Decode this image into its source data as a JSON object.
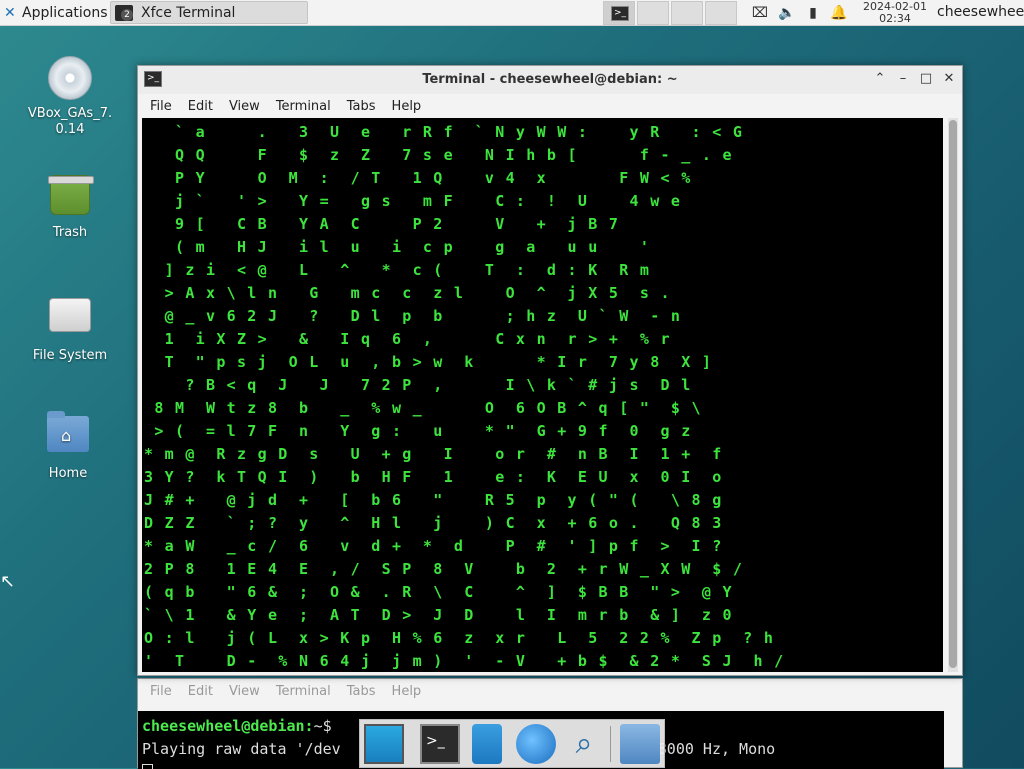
{
  "panel": {
    "applications_label": "Applications",
    "applications_sep": "☰",
    "task_label": "Xfce Terminal",
    "task_badge": "2",
    "clock_date": "2024-02-01",
    "clock_time": "02:34",
    "user": "cheesewheel",
    "tray_icons": [
      "network-icon",
      "volume-icon",
      "battery-icon",
      "notification-bell-icon"
    ]
  },
  "desktop": {
    "icons": [
      {
        "name": "VBox_GAs_7.\n0.14",
        "icon": "disc-icon"
      },
      {
        "name": "Trash",
        "icon": "trash-icon"
      },
      {
        "name": "File System",
        "icon": "drive-icon"
      },
      {
        "name": "Home",
        "icon": "home-folder-icon"
      }
    ]
  },
  "front_window": {
    "title": "Terminal - cheesewheel@debian: ~",
    "menu": [
      "File",
      "Edit",
      "View",
      "Terminal",
      "Tabs",
      "Help"
    ],
    "matrix_rows": [
      "   ` a     .   3  U  e   r R f  ` N y W W :    y R   : < G",
      "   Q Q     F   $  z  Z   7 s e   N I h b [      f - _ . e",
      "   P Y     O  M  :  / T   1 Q    v 4  x       F W < %",
      "   j `   ' >   Y =   g s   m F    C :  !  U    4 w e",
      "   9 [   C B   Y A  C     P 2     V   +  j B 7",
      "   ( m   H J   i l  u   i  c p    g  a   u u    '",
      "  ] z i  < @   L   ^   *  c (    T  :  d : K  R m",
      "  > A x \\ l n   G   m c  c  z l    O  ^  j X 5  s .",
      "  @ _ v 6 2 J   ?   D l  p  b      ; h z  U ` W  - n",
      "  1  i X Z >   &   I q  6  ,      C x n  r > +  % r",
      "  T  \" p s j  O L  u  , b > w  k      * I r  7 y 8  X ]",
      "    ? B < q  J   J   7 2 P  ,      I \\ k ` # j s  D l",
      " 8 M  W t z 8  b   _  % w _      O  6 O B ^ q [ \"  $ \\",
      " > (  = l 7 F  n   Y  g :   u    * \"  G + 9 f  0  g z",
      "* m @  R z g D  s   U  + g   I    o r  #  n B  I  1 +  f",
      "3 Y ?  k T Q I  )   b  H F   1    e :  K  E U  x  0 I  o",
      "J # +   @ j d  +   [  b 6   \"    R 5  p  y ( \" (   \\ 8 g",
      "D Z Z   ` ; ?  y   ^  H l   j    ) C  x  + 6 o .   Q 8 3",
      "* a W   _ c /  6   v  d +  *  d    P  #  ' ] p f  >  I ?",
      "2 P 8   1 E 4  E  , /  S P  8  V    b  2  + r W _ X W  $ /",
      "( q b   \" 6 &  ;  O &  . R  \\  C    ^  ]  $ B B  \" >  @ Y",
      "` \\ 1   & Y e  ;  A T  D >  J  D    l  I  m r b  & ]  z 0",
      "O : l   j ( L  x > K p  H % 6  z  x r   L  5  2 2 %  Z p  ? h",
      "'  T    D -  % N 6 4 j  j m )  '  - V   + b $  & 2 *  S J  h /"
    ]
  },
  "back_window": {
    "menu": [
      "File",
      "Edit",
      "View",
      "Terminal",
      "Tabs",
      "Help"
    ],
    "prompt": "cheesewheel@debian:",
    "prompt_suffix": "~$",
    "line2_left": "Playing raw data '/dev",
    "line2_right": "te 8000 Hz, Mono"
  },
  "colors": {
    "matrix_green": "#3ee43e",
    "matrix_white": "#ffffff",
    "terminal_bg": "#000000",
    "prompt_green": "#4ee94e"
  },
  "dock": {
    "items": [
      "show-desktop-icon",
      "terminal-icon",
      "file-cabinet-icon",
      "web-browser-icon",
      "app-finder-icon",
      "folder-icon"
    ]
  }
}
